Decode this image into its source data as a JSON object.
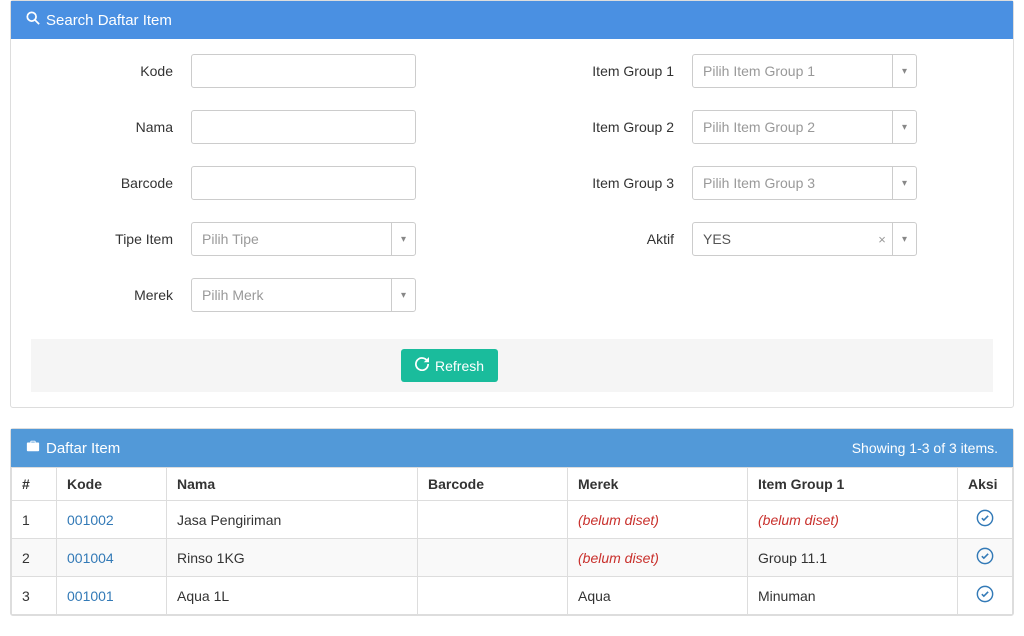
{
  "searchPanel": {
    "title": "Search Daftar Item",
    "labels": {
      "kode": "Kode",
      "nama": "Nama",
      "barcode": "Barcode",
      "tipeItem": "Tipe Item",
      "merek": "Merek",
      "itemGroup1": "Item Group 1",
      "itemGroup2": "Item Group 2",
      "itemGroup3": "Item Group 3",
      "aktif": "Aktif"
    },
    "placeholders": {
      "tipe": "Pilih Tipe",
      "merk": "Pilih Merk",
      "ig1": "Pilih Item Group 1",
      "ig2": "Pilih Item Group 2",
      "ig3": "Pilih Item Group 3"
    },
    "values": {
      "kode": "",
      "nama": "",
      "barcode": "",
      "aktif": "YES"
    },
    "refresh": "Refresh"
  },
  "listPanel": {
    "title": "Daftar Item",
    "summary": "Showing 1-3 of 3 items.",
    "columns": {
      "num": "#",
      "kode": "Kode",
      "nama": "Nama",
      "barcode": "Barcode",
      "merek": "Merek",
      "itemGroup1": "Item Group 1",
      "aksi": "Aksi"
    },
    "unsetText": "(belum diset)",
    "rows": [
      {
        "num": "1",
        "kode": "001002",
        "nama": "Jasa Pengiriman",
        "barcode": "",
        "merek": null,
        "itemGroup1": null
      },
      {
        "num": "2",
        "kode": "001004",
        "nama": "Rinso 1KG",
        "barcode": "",
        "merek": null,
        "itemGroup1": "Group 11.1"
      },
      {
        "num": "3",
        "kode": "001001",
        "nama": "Aqua 1L",
        "barcode": "",
        "merek": "Aqua",
        "itemGroup1": "Minuman"
      }
    ]
  }
}
